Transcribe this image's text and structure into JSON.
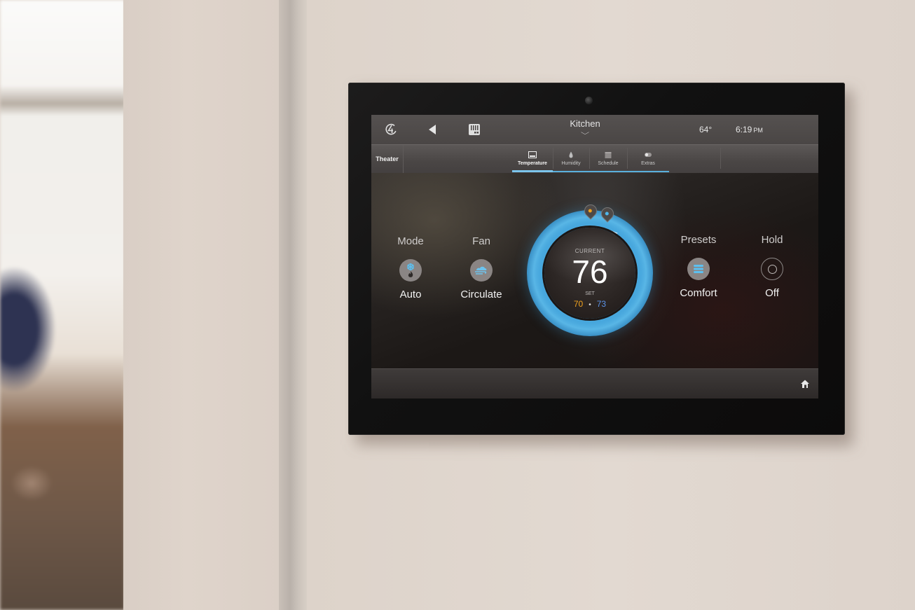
{
  "topbar": {
    "logo_icon": "brand-logo-icon",
    "back_icon": "back-triangle-icon",
    "device_icon": "thermostat-device-icon",
    "room_name": "Kitchen",
    "room_chevron": "⌵",
    "outdoor_temp": "64°",
    "time": "6:19",
    "ampm": "PM"
  },
  "tabbar": {
    "room_left": "Theater",
    "tabs": [
      {
        "label": "Temperature",
        "icon": "monitor-icon",
        "active": true
      },
      {
        "label": "Humidity",
        "icon": "droplet-icon",
        "active": false
      },
      {
        "label": "Schedule",
        "icon": "calendar-icon",
        "active": false
      },
      {
        "label": "Extras",
        "icon": "toggle-icon",
        "active": false
      }
    ]
  },
  "controls": {
    "mode": {
      "title": "Mode",
      "value": "Auto",
      "icon": "snowflake-flame-icon"
    },
    "fan": {
      "title": "Fan",
      "value": "Circulate",
      "icon": "wind-cloud-icon"
    },
    "presets": {
      "title": "Presets",
      "value": "Comfort",
      "icon": "list-icon"
    },
    "hold": {
      "title": "Hold",
      "value": "Off",
      "icon": "radio-ring-icon"
    }
  },
  "thermostat": {
    "current_label": "CURRENT",
    "current_temp": "76",
    "set_label": "SET",
    "heat_setpoint": "70",
    "separator": "•",
    "cool_setpoint": "73"
  },
  "colors": {
    "accent_blue": "#5ab0dc",
    "heat": "#f0a21e",
    "cool": "#5b92e6"
  },
  "bottombar": {
    "home_icon": "home-icon"
  }
}
